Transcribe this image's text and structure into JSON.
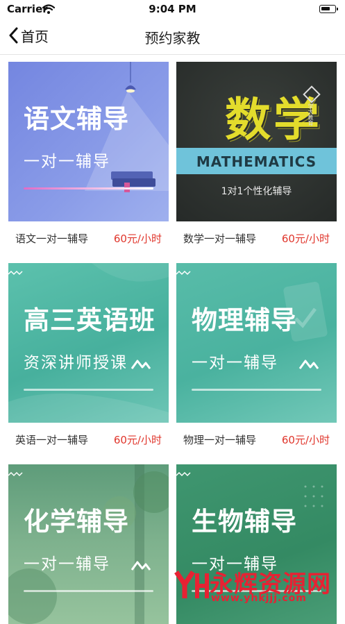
{
  "status_bar": {
    "carrier": "Carrier",
    "time": "9:04 PM"
  },
  "nav": {
    "back_label": "首页",
    "title": "预约家教"
  },
  "courses": [
    {
      "thumb_title": "语文辅导",
      "thumb_subtitle": "一对一辅导",
      "name": "语文一对一辅导",
      "price": "60元/小时",
      "bg": "#7f8fe0"
    },
    {
      "thumb_title": "数学",
      "thumb_band": "MATHEMATICS",
      "thumb_subtitle": "1对1个性化辅导",
      "thumb_logo": "学大教育",
      "name": "数学一对一辅导",
      "price": "60元/小时",
      "bg": "#2d3230"
    },
    {
      "thumb_title": "高三英语班",
      "thumb_subtitle": "资深讲师授课",
      "name": "英语一对一辅导",
      "price": "60元/小时",
      "bg": "#4fb9a5"
    },
    {
      "thumb_title": "物理辅导",
      "thumb_subtitle": "一对一辅导",
      "name": "物理一对一辅导",
      "price": "60元/小时",
      "bg": "#52b8a6"
    },
    {
      "thumb_title": "化学辅导",
      "thumb_subtitle": "一对一辅导",
      "bg": "#5d9a78"
    },
    {
      "thumb_title": "生物辅导",
      "thumb_subtitle": "一对一辅导",
      "bg": "#3d8f6a"
    }
  ],
  "watermark": {
    "text": "永辉资源网",
    "url": "www.yhkjjj.com"
  },
  "colors": {
    "price": "#e0352b",
    "divider": "#e4e4e4"
  }
}
